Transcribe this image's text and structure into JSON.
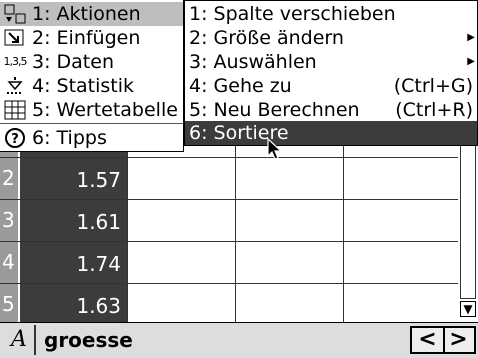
{
  "main_menu": {
    "items": [
      {
        "label": "1: Aktionen",
        "icon": "actions-icon"
      },
      {
        "label": "2: Einfügen",
        "icon": "insert-icon"
      },
      {
        "label": "3: Daten",
        "icon": "data-icon",
        "icon_text": "1,3,5"
      },
      {
        "label": "4: Statistik",
        "icon": "statistics-icon"
      },
      {
        "label": "5: Wertetabelle",
        "icon": "table-icon"
      },
      {
        "label": "6: Tipps",
        "icon": "hints-icon",
        "icon_text": "?"
      }
    ]
  },
  "submenu": {
    "items": [
      {
        "label": "1: Spalte verschieben",
        "shortcut": ""
      },
      {
        "label": "2: Größe ändern",
        "shortcut": ""
      },
      {
        "label": "3: Auswählen",
        "shortcut": ""
      },
      {
        "label": "4: Gehe zu",
        "shortcut": "(Ctrl+G)"
      },
      {
        "label": "5: Neu Berechnen",
        "shortcut": "(Ctrl+R)"
      },
      {
        "label": "6: Sortiere",
        "shortcut": ""
      }
    ]
  },
  "table": {
    "rows": [
      {
        "num": "2",
        "value": "1.57"
      },
      {
        "num": "3",
        "value": "1.61"
      },
      {
        "num": "4",
        "value": "1.74"
      },
      {
        "num": "5",
        "value": "1.63"
      }
    ]
  },
  "entry_line": {
    "column_letter": "A",
    "name": "groesse"
  },
  "scroll": {
    "down_glyph": "▼"
  },
  "nav": {
    "left": "<",
    "right": ">"
  }
}
